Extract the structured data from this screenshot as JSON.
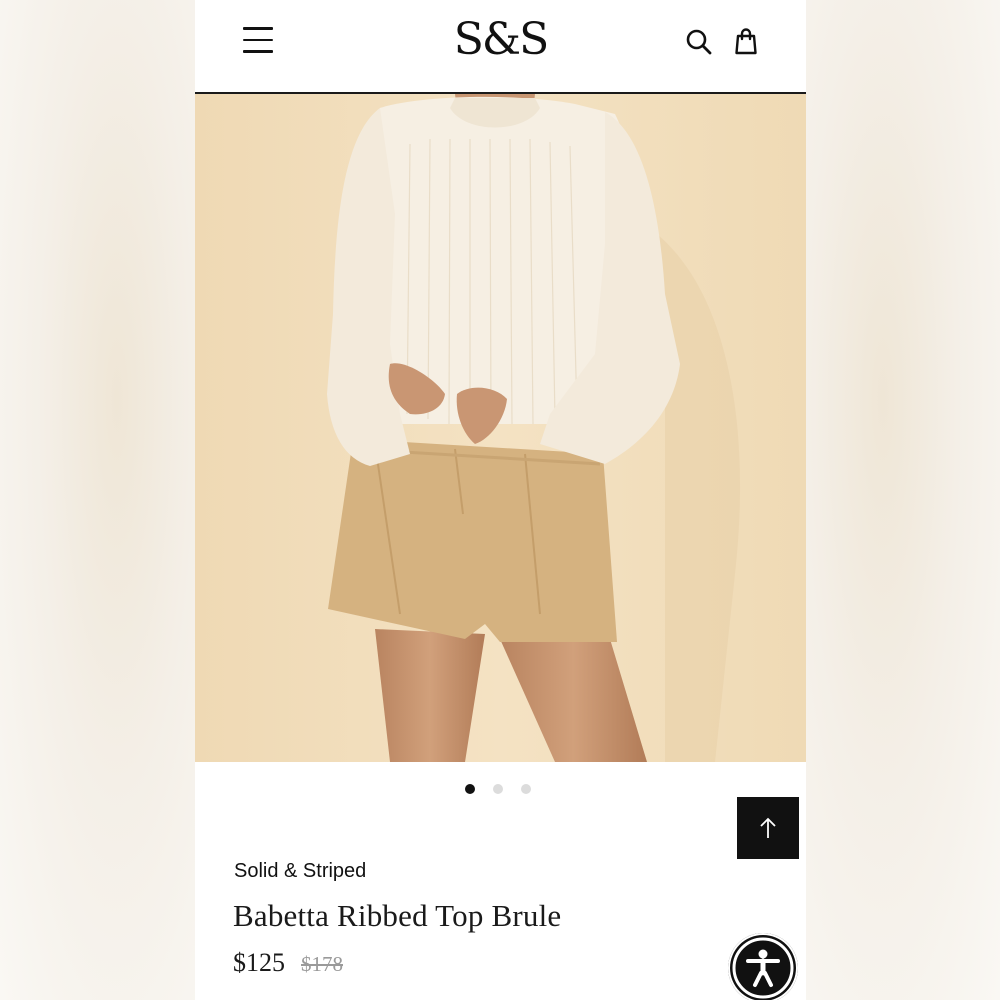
{
  "header": {
    "logo": "S&S",
    "menu_icon": "hamburger-menu-icon",
    "search_icon": "search-icon",
    "bag_icon": "shopping-bag-icon"
  },
  "gallery": {
    "image_count": 3,
    "active_index": 0
  },
  "product": {
    "brand": "Solid & Striped",
    "name": "Babetta Ribbed Top Brule",
    "price": "$125",
    "original_price": "$178"
  },
  "buttons": {
    "back_to_top_icon": "arrow-up-icon",
    "accessibility_icon": "accessibility-person-icon"
  },
  "colors": {
    "text": "#111111",
    "strikethrough_price": "#9a9a9a",
    "hero_background": "#f0dcb8",
    "sweater": "#f6efe3",
    "shorts": "#d5b280",
    "skin": "#c89672"
  }
}
